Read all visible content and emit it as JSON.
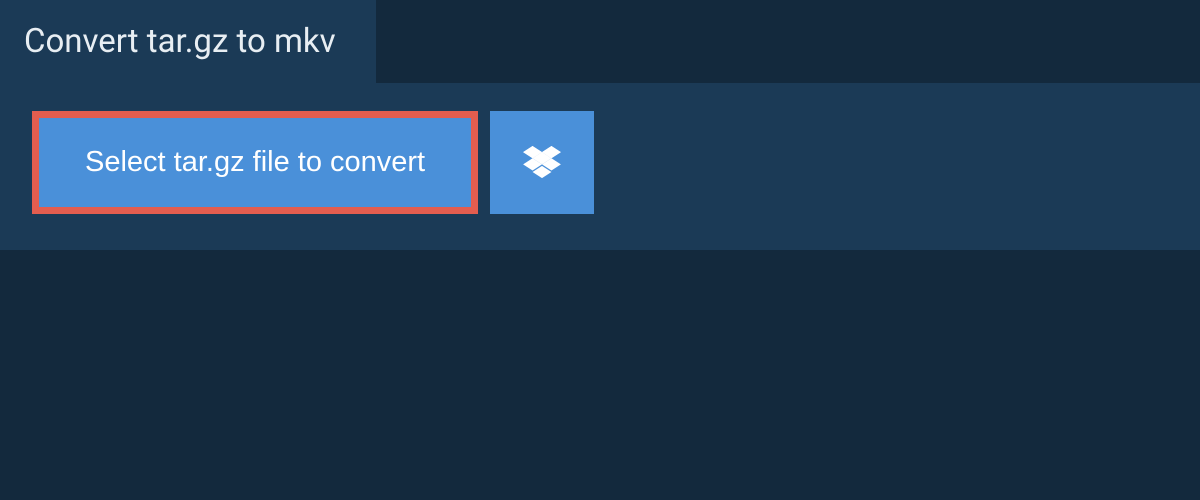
{
  "tab": {
    "title": "Convert tar.gz to mkv"
  },
  "actions": {
    "select_file_label": "Select tar.gz file to convert",
    "dropbox_icon": "dropbox-icon"
  },
  "colors": {
    "background": "#13293d",
    "panel": "#1b3a56",
    "button": "#4a90d9",
    "highlight_border": "#e35d4f",
    "text_light": "#e8eef3",
    "text_white": "#ffffff"
  }
}
